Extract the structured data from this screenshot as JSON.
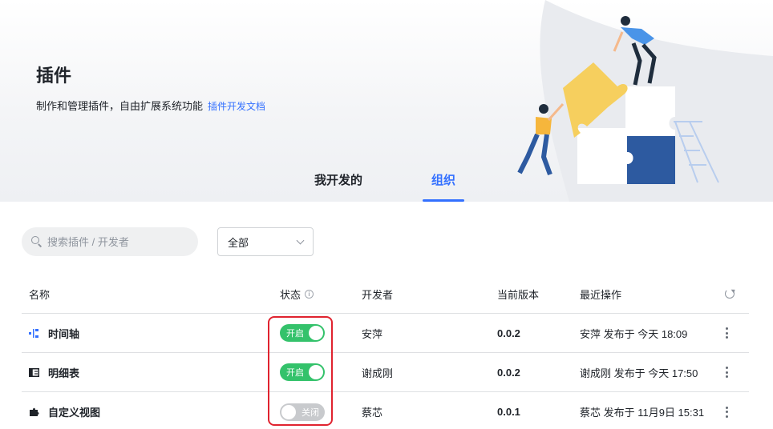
{
  "header": {
    "title": "插件",
    "subtitle": "制作和管理插件，自由扩展系统功能",
    "doc_link": "插件开发文档"
  },
  "tabs": [
    {
      "label": "我开发的",
      "active": false
    },
    {
      "label": "组织",
      "active": true
    }
  ],
  "search": {
    "placeholder": "搜索插件 / 开发者",
    "value": ""
  },
  "filter": {
    "selected": "全部"
  },
  "table": {
    "columns": {
      "name": "名称",
      "status": "状态",
      "developer": "开发者",
      "version": "当前版本",
      "last_op": "最近操作"
    },
    "rows": [
      {
        "icon": "timeline-icon",
        "name": "时间轴",
        "status": "开启",
        "status_on": true,
        "developer": "安萍",
        "version": "0.0.2",
        "last_op": "安萍 发布于 今天 18:09"
      },
      {
        "icon": "detail-table-icon",
        "name": "明细表",
        "status": "开启",
        "status_on": true,
        "developer": "谢成刚",
        "version": "0.0.2",
        "last_op": "谢成刚 发布于 今天 17:50"
      },
      {
        "icon": "puzzle-icon",
        "name": "自定义视图",
        "status": "关闭",
        "status_on": false,
        "developer": "蔡芯",
        "version": "0.0.1",
        "last_op": "蔡芯 发布于 11月9日 15:31"
      }
    ]
  },
  "colors": {
    "accent": "#3370ff",
    "toggle_on": "#34c26b",
    "toggle_off": "#c8cacd",
    "highlight": "#e0232f"
  }
}
